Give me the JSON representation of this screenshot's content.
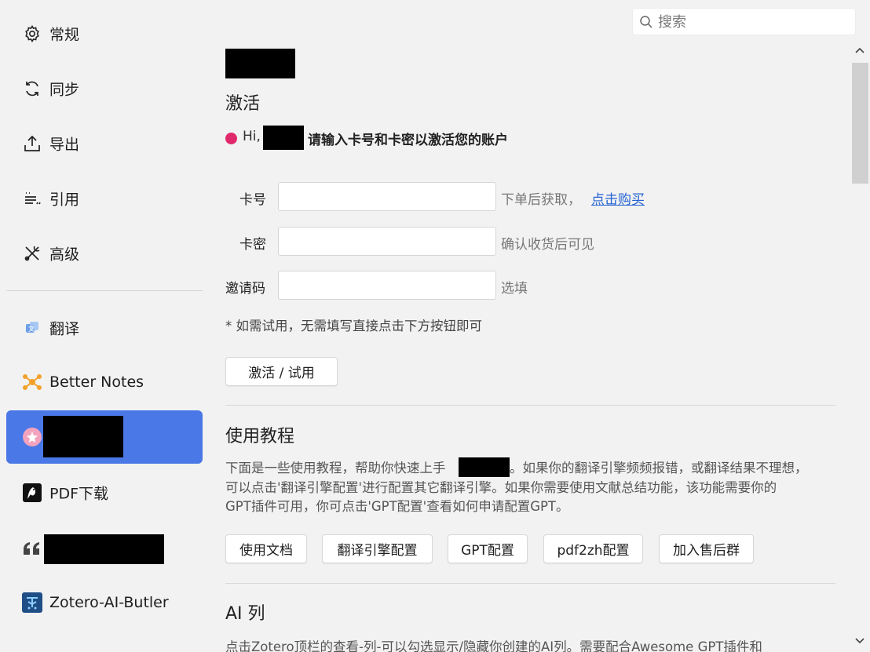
{
  "search": {
    "placeholder": "搜索"
  },
  "sidebar": {
    "items": [
      {
        "label": "常规",
        "icon": "gear-icon"
      },
      {
        "label": "同步",
        "icon": "sync-icon"
      },
      {
        "label": "导出",
        "icon": "export-icon"
      },
      {
        "label": "引用",
        "icon": "cite-icon"
      },
      {
        "label": "高级",
        "icon": "tools-icon"
      },
      {
        "label": "翻译",
        "icon": "translate-icon"
      },
      {
        "label": "Better Notes",
        "icon": "better-notes-icon"
      },
      {
        "label": "",
        "icon": "plugin-icon",
        "active": true
      },
      {
        "label": "PDF下载",
        "icon": "pdf-download-icon"
      },
      {
        "label": "",
        "icon": "quote-icon"
      },
      {
        "label": "Zotero-AI-Butler",
        "icon": "ai-butler-icon"
      }
    ]
  },
  "activation": {
    "title": "激活",
    "greeting": "Hi,",
    "message": "请输入卡号和卡密以激活您的账户",
    "status_color": "#e0296a",
    "card_number": {
      "label": "卡号",
      "value": "",
      "hint": "下单后获取，",
      "link": "点击购买"
    },
    "card_secret": {
      "label": "卡密",
      "value": "",
      "hint": "确认收货后可见"
    },
    "invite_code": {
      "label": "邀请码",
      "value": "",
      "hint": "选填"
    },
    "note": "* 如需试用，无需填写直接点击下方按钮即可",
    "button": "激活 / 试用"
  },
  "tutorial": {
    "title": "使用教程",
    "line1_a": "下面是一些使用教程，帮助你快速上手",
    "line1_b": "。如果你的翻译引擎频频报错，或翻译结果不理想，",
    "line2": "可以点击'翻译引擎配置'进行配置其它翻译引擎。如果你需要使用文献总结功能，该功能需要你的",
    "line3": "GPT插件可用，你可点击'GPT配置'查看如何申请配置GPT。",
    "buttons": [
      "使用文档",
      "翻译引擎配置",
      "GPT配置",
      "pdf2zh配置",
      "加入售后群"
    ]
  },
  "ai_column": {
    "title": "AI 列",
    "text": "点击Zotero顶栏的查看-列-可以勾选显示/隐藏你创建的AI列。需要配合Awesome GPT插件和"
  },
  "colors": {
    "accent": "#4a78e6",
    "link": "#2463d1",
    "background": "#f2f2f2"
  }
}
